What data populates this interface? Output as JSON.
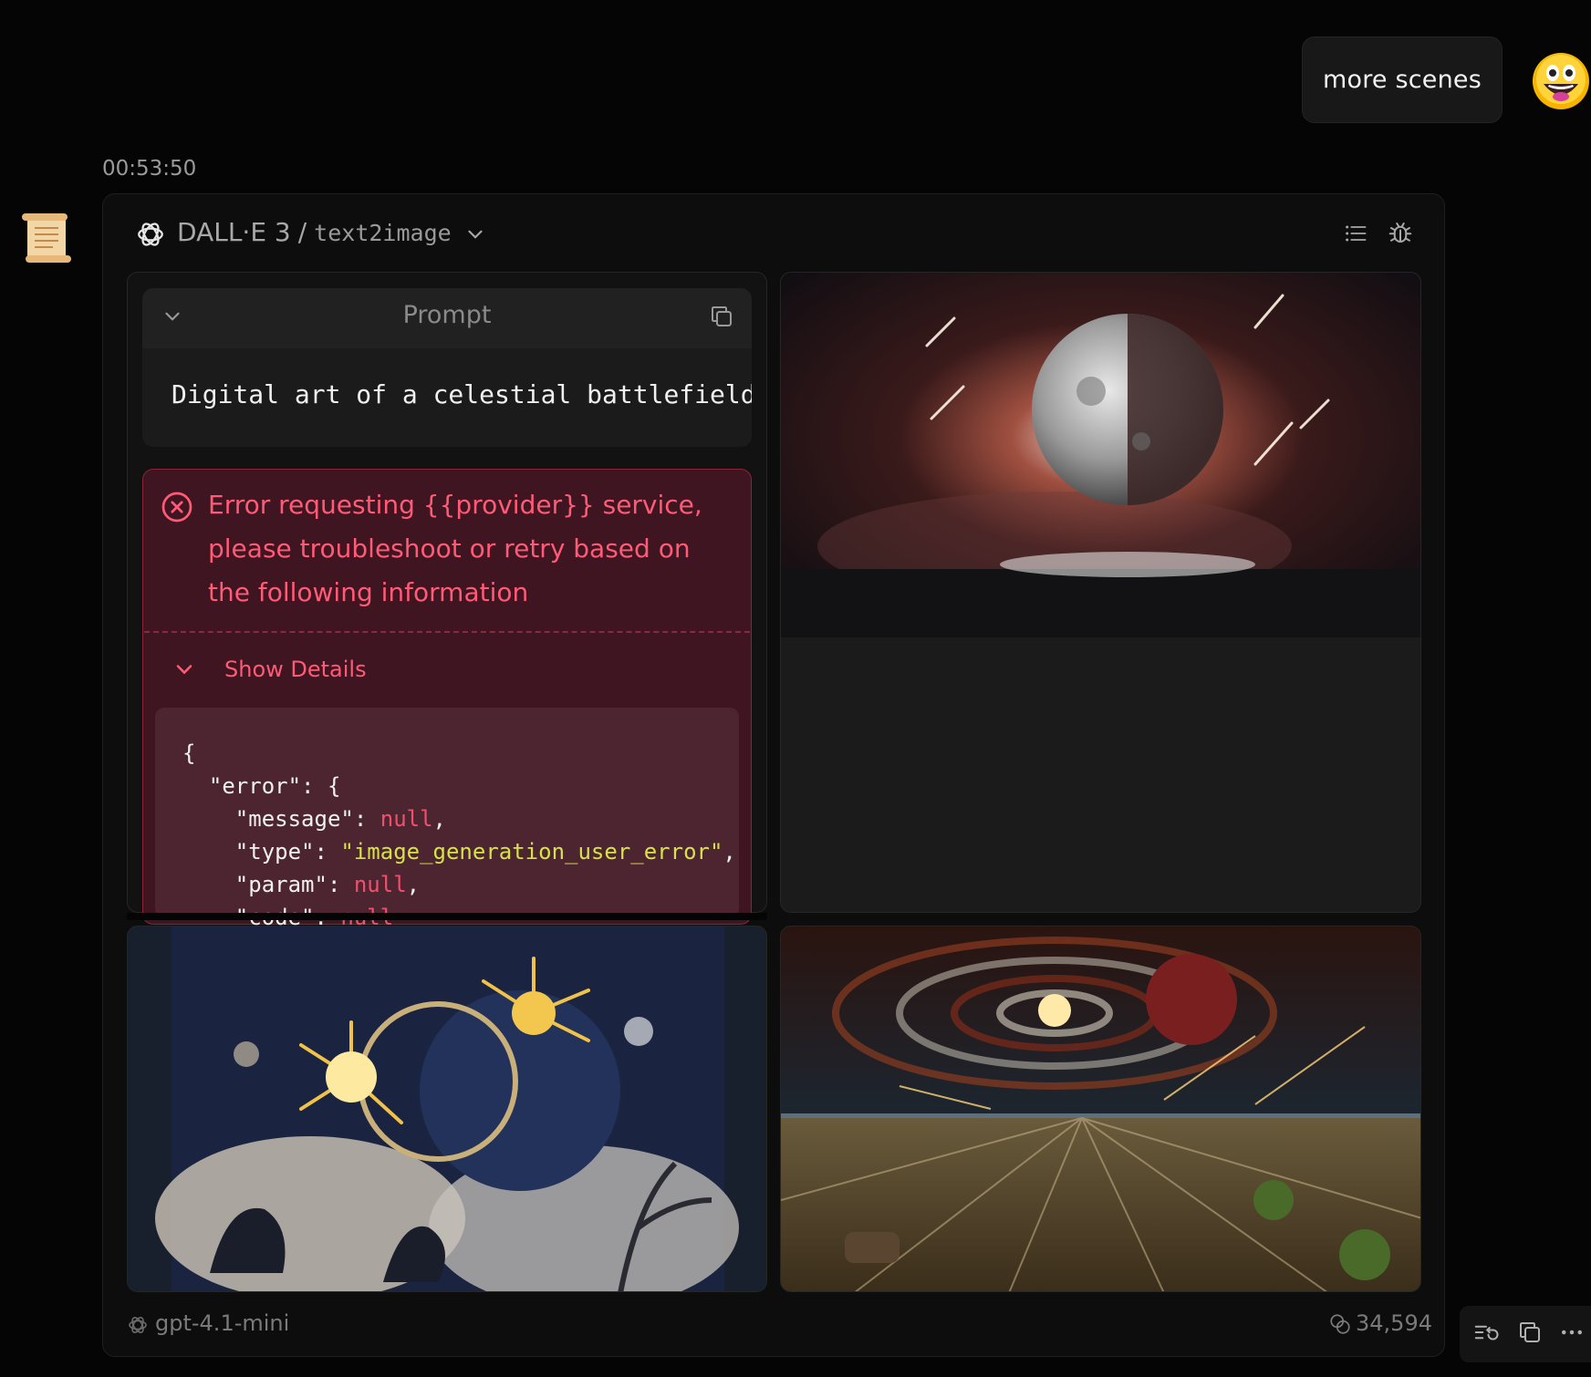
{
  "user_message": {
    "text": "more scenes"
  },
  "timestamp": "00:53:50",
  "tool_header": {
    "provider": "DALL·E 3",
    "separator": "/",
    "tool": "text2image"
  },
  "prompt": {
    "label": "Prompt",
    "text": "Digital art of a celestial battlefield"
  },
  "error": {
    "message": "Error requesting {{provider}} service, please troubleshoot or retry based on the following information",
    "details_label": "Show Details",
    "code_lines": [
      "{",
      "  \"error\": {",
      "    \"message\": null,",
      "    \"type\": \"image_generation_user_error\",",
      "    \"param\": null,",
      "    \"code\": null"
    ]
  },
  "footer": {
    "model": "gpt-4.1-mini",
    "usage": "34,594"
  },
  "colors": {
    "error_text": "#ff5a76",
    "error_bg": "#3e1520",
    "null_token": "#f0506e",
    "string_token": "#d7e14a"
  },
  "icons": [
    "scroll-icon",
    "openai-logo-icon",
    "chevron-down-icon",
    "list-icon",
    "bug-icon",
    "copy-icon",
    "error-circle-x-icon",
    "token-usage-icon",
    "regenerate-icon",
    "more-icon"
  ]
}
